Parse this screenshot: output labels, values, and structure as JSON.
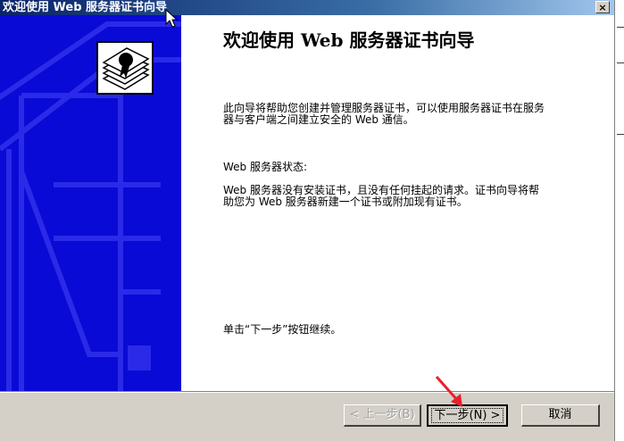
{
  "window": {
    "title": "欢迎使用 Web 服务器证书向导",
    "close_label": "×"
  },
  "content": {
    "heading": "欢迎使用 Web 服务器证书向导",
    "intro": "此向导将帮助您创建并管理服务器证书，可以使用服务器证书在服务器与客户端之间建立安全的 Web 通信。",
    "status_label": "Web 服务器状态:",
    "status_text": "Web 服务器没有安装证书，且没有任何挂起的请求。证书向导将帮助您为 Web 服务器新建一个证书或附加现有证书。",
    "continue_hint": "单击“下一步”按钮继续。"
  },
  "buttons": {
    "back": "< 上一步(B)",
    "next": "下一步(N) >",
    "cancel": "取消"
  },
  "icons": {
    "wizard_graphic": "certificate-icon",
    "annotation": "red-arrow-icon",
    "pointer": "mouse-cursor-icon"
  },
  "colors": {
    "side_panel": "#0a0ad6",
    "title_bar": "#0a246a",
    "annotation": "#e8202a"
  }
}
